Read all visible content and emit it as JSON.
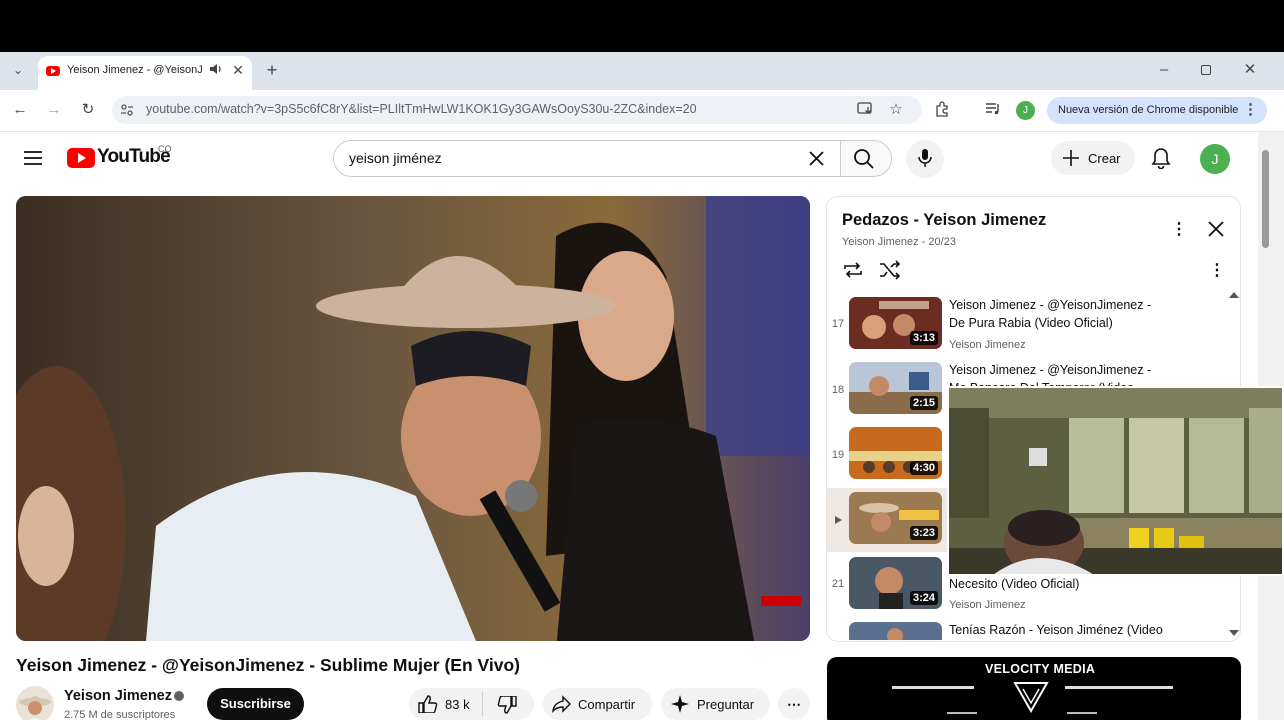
{
  "browser": {
    "tab_title": "Yeison Jimenez - @YeisonJi",
    "url": "youtube.com/watch?v=3pS5c6fC8rY&list=PLIltTmHwLW1KOK1Gy3GAWsOoyS30u-2ZC&index=20",
    "update_label": "Nueva versión de Chrome disponible",
    "profile_initial": "J"
  },
  "header": {
    "logo_text": "YouTube",
    "country_code": "CO",
    "search_value": "yeison jiménez",
    "create_label": "Crear",
    "avatar_initial": "J"
  },
  "video": {
    "title": "Yeison Jimenez - @YeisonJimenez - Sublime Mujer (En Vivo)",
    "channel": "Yeison Jimenez",
    "subscribers": "2.75 M de suscriptores",
    "subscribe_label": "Suscribirse",
    "likes": "83 k",
    "share_label": "Compartir",
    "ask_label": "Preguntar"
  },
  "playlist": {
    "title": "Pedazos - Yeison Jimenez",
    "subtitle": "Yeison Jimenez - 20/23",
    "items": [
      {
        "index": "17",
        "title_line1": "Yeison Jimenez - @YeisonJimenez -",
        "title_line2": "De Pura Rabia (Video Oficial)",
        "channel": "Yeison Jimenez",
        "duration": "3:13"
      },
      {
        "index": "18",
        "title_line1": "Yeison Jimenez - @YeisonJimenez -",
        "title_line2": "Me Bancaro Del Temporor (Video...",
        "channel": "",
        "duration": "2:15"
      },
      {
        "index": "19",
        "duration": "4:30"
      },
      {
        "index": "",
        "duration": "3:23"
      },
      {
        "index": "21",
        "title_line1": "Necesito (Video Oficial)",
        "channel": "Yeison Jimenez",
        "duration": "3:24"
      },
      {
        "index": "",
        "title_line1": "Tenías Razón - Yeison Jiménez (Video"
      }
    ]
  },
  "ad": {
    "brand": "VELOCITY MEDIA"
  },
  "icons": {
    "tab_audio": "speaker-icon",
    "accent_red": "#ff0000",
    "avatar_green": "#4caf50"
  }
}
